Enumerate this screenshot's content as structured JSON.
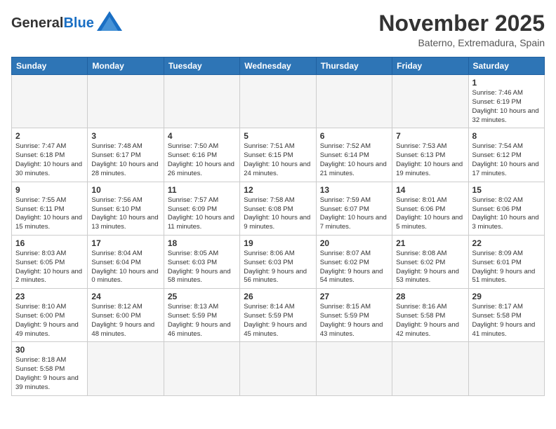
{
  "header": {
    "logo_general": "General",
    "logo_blue": "Blue",
    "month_title": "November 2025",
    "location": "Baterno, Extremadura, Spain"
  },
  "days_of_week": [
    "Sunday",
    "Monday",
    "Tuesday",
    "Wednesday",
    "Thursday",
    "Friday",
    "Saturday"
  ],
  "weeks": [
    [
      {
        "day": "",
        "info": ""
      },
      {
        "day": "",
        "info": ""
      },
      {
        "day": "",
        "info": ""
      },
      {
        "day": "",
        "info": ""
      },
      {
        "day": "",
        "info": ""
      },
      {
        "day": "",
        "info": ""
      },
      {
        "day": "1",
        "info": "Sunrise: 7:46 AM\nSunset: 6:19 PM\nDaylight: 10 hours and 32 minutes."
      }
    ],
    [
      {
        "day": "2",
        "info": "Sunrise: 7:47 AM\nSunset: 6:18 PM\nDaylight: 10 hours and 30 minutes."
      },
      {
        "day": "3",
        "info": "Sunrise: 7:48 AM\nSunset: 6:17 PM\nDaylight: 10 hours and 28 minutes."
      },
      {
        "day": "4",
        "info": "Sunrise: 7:50 AM\nSunset: 6:16 PM\nDaylight: 10 hours and 26 minutes."
      },
      {
        "day": "5",
        "info": "Sunrise: 7:51 AM\nSunset: 6:15 PM\nDaylight: 10 hours and 24 minutes."
      },
      {
        "day": "6",
        "info": "Sunrise: 7:52 AM\nSunset: 6:14 PM\nDaylight: 10 hours and 21 minutes."
      },
      {
        "day": "7",
        "info": "Sunrise: 7:53 AM\nSunset: 6:13 PM\nDaylight: 10 hours and 19 minutes."
      },
      {
        "day": "8",
        "info": "Sunrise: 7:54 AM\nSunset: 6:12 PM\nDaylight: 10 hours and 17 minutes."
      }
    ],
    [
      {
        "day": "9",
        "info": "Sunrise: 7:55 AM\nSunset: 6:11 PM\nDaylight: 10 hours and 15 minutes."
      },
      {
        "day": "10",
        "info": "Sunrise: 7:56 AM\nSunset: 6:10 PM\nDaylight: 10 hours and 13 minutes."
      },
      {
        "day": "11",
        "info": "Sunrise: 7:57 AM\nSunset: 6:09 PM\nDaylight: 10 hours and 11 minutes."
      },
      {
        "day": "12",
        "info": "Sunrise: 7:58 AM\nSunset: 6:08 PM\nDaylight: 10 hours and 9 minutes."
      },
      {
        "day": "13",
        "info": "Sunrise: 7:59 AM\nSunset: 6:07 PM\nDaylight: 10 hours and 7 minutes."
      },
      {
        "day": "14",
        "info": "Sunrise: 8:01 AM\nSunset: 6:06 PM\nDaylight: 10 hours and 5 minutes."
      },
      {
        "day": "15",
        "info": "Sunrise: 8:02 AM\nSunset: 6:06 PM\nDaylight: 10 hours and 3 minutes."
      }
    ],
    [
      {
        "day": "16",
        "info": "Sunrise: 8:03 AM\nSunset: 6:05 PM\nDaylight: 10 hours and 2 minutes."
      },
      {
        "day": "17",
        "info": "Sunrise: 8:04 AM\nSunset: 6:04 PM\nDaylight: 10 hours and 0 minutes."
      },
      {
        "day": "18",
        "info": "Sunrise: 8:05 AM\nSunset: 6:03 PM\nDaylight: 9 hours and 58 minutes."
      },
      {
        "day": "19",
        "info": "Sunrise: 8:06 AM\nSunset: 6:03 PM\nDaylight: 9 hours and 56 minutes."
      },
      {
        "day": "20",
        "info": "Sunrise: 8:07 AM\nSunset: 6:02 PM\nDaylight: 9 hours and 54 minutes."
      },
      {
        "day": "21",
        "info": "Sunrise: 8:08 AM\nSunset: 6:02 PM\nDaylight: 9 hours and 53 minutes."
      },
      {
        "day": "22",
        "info": "Sunrise: 8:09 AM\nSunset: 6:01 PM\nDaylight: 9 hours and 51 minutes."
      }
    ],
    [
      {
        "day": "23",
        "info": "Sunrise: 8:10 AM\nSunset: 6:00 PM\nDaylight: 9 hours and 49 minutes."
      },
      {
        "day": "24",
        "info": "Sunrise: 8:12 AM\nSunset: 6:00 PM\nDaylight: 9 hours and 48 minutes."
      },
      {
        "day": "25",
        "info": "Sunrise: 8:13 AM\nSunset: 5:59 PM\nDaylight: 9 hours and 46 minutes."
      },
      {
        "day": "26",
        "info": "Sunrise: 8:14 AM\nSunset: 5:59 PM\nDaylight: 9 hours and 45 minutes."
      },
      {
        "day": "27",
        "info": "Sunrise: 8:15 AM\nSunset: 5:59 PM\nDaylight: 9 hours and 43 minutes."
      },
      {
        "day": "28",
        "info": "Sunrise: 8:16 AM\nSunset: 5:58 PM\nDaylight: 9 hours and 42 minutes."
      },
      {
        "day": "29",
        "info": "Sunrise: 8:17 AM\nSunset: 5:58 PM\nDaylight: 9 hours and 41 minutes."
      }
    ],
    [
      {
        "day": "30",
        "info": "Sunrise: 8:18 AM\nSunset: 5:58 PM\nDaylight: 9 hours and 39 minutes."
      },
      {
        "day": "",
        "info": ""
      },
      {
        "day": "",
        "info": ""
      },
      {
        "day": "",
        "info": ""
      },
      {
        "day": "",
        "info": ""
      },
      {
        "day": "",
        "info": ""
      },
      {
        "day": "",
        "info": ""
      }
    ]
  ]
}
